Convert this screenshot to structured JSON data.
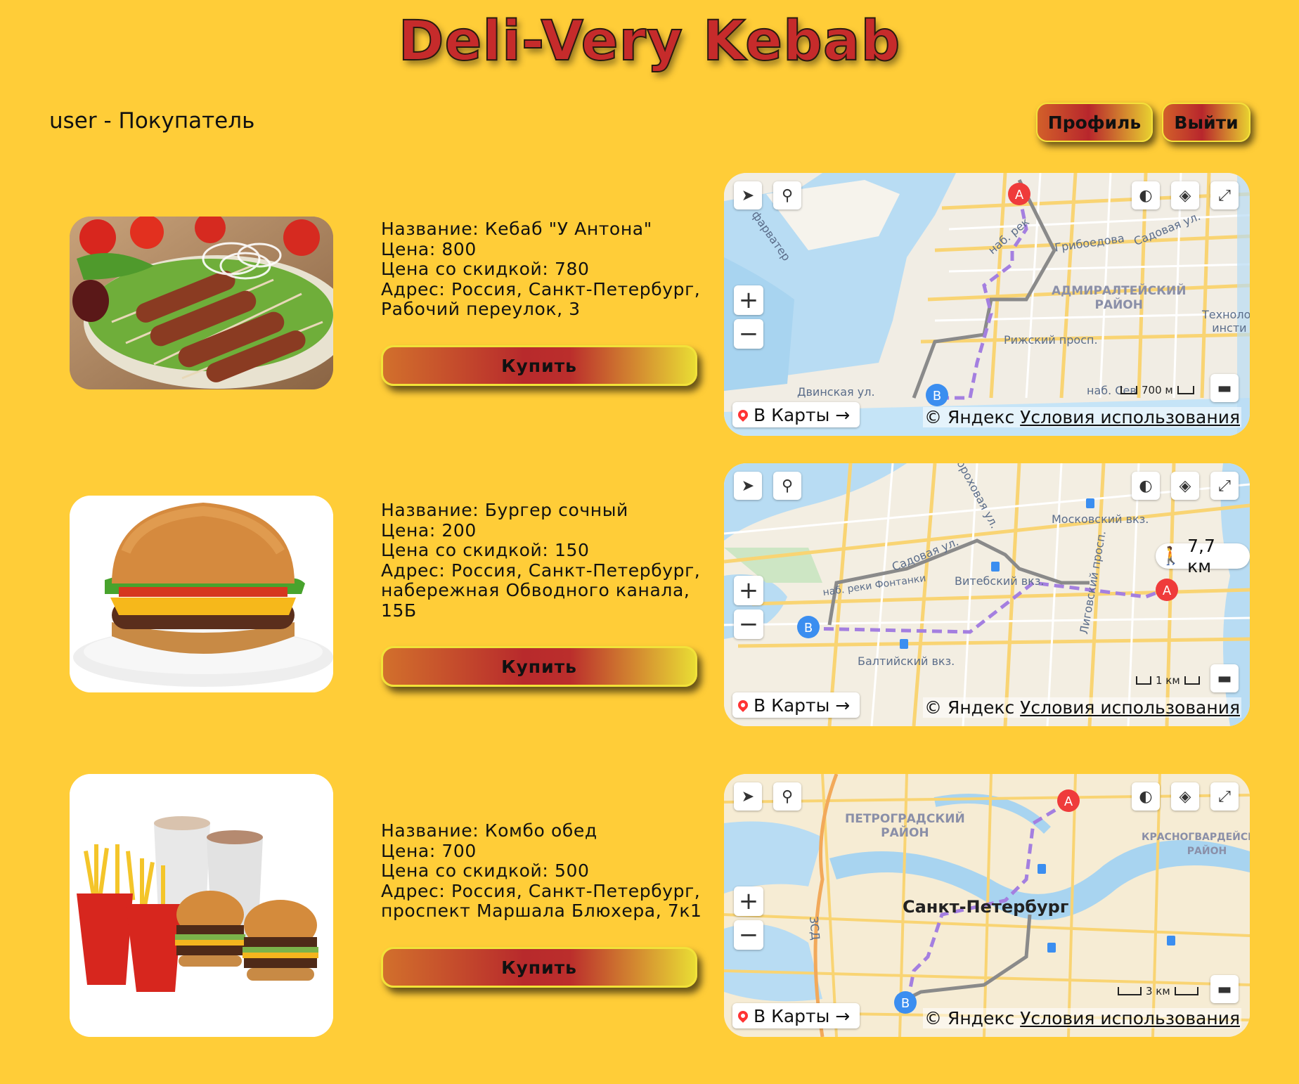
{
  "header": {
    "title": "Deli-Very Kebab",
    "user_line": "user - Покупатель",
    "profile_label": "Профиль",
    "logout_label": "Выйти"
  },
  "colors": {
    "background": "#ffcd38",
    "title_red": "#c62b2b",
    "route_purple": "#a47fe0"
  },
  "products": [
    {
      "name_line": "Название: Кебаб \"У Антона\"",
      "price_line": "Цена: 800",
      "discount_line": "Цена со скидкой: 780",
      "address_line1": "Адрес: Россия, Санкт-Петербург,",
      "address_line2": "Рабочий переулок, 3",
      "address_line3": "",
      "buy_label": "Купить",
      "image_icon": "kebab-photo"
    },
    {
      "name_line": "Название: Бургер сочный",
      "price_line": "Цена: 200",
      "discount_line": "Цена со скидкой: 150",
      "address_line1": "Адрес: Россия, Санкт-Петербург,",
      "address_line2": "набережная Обводного канала,",
      "address_line3": "15Б",
      "buy_label": "Купить",
      "image_icon": "burger-photo"
    },
    {
      "name_line": "Название: Комбо обед",
      "price_line": "Цена: 700",
      "discount_line": "Цена со скидкой: 500",
      "address_line1": "Адрес: Россия, Санкт-Петербург,",
      "address_line2": "проспект Маршала Блюхера, 7к1",
      "address_line3": "",
      "buy_label": "Купить",
      "image_icon": "combo-meal-photo"
    }
  ],
  "maps": [
    {
      "open_label": "В Карты →",
      "copyright": "© Яндекс",
      "terms": "Условия использования",
      "scale": "700 м",
      "distance": "",
      "labels": {
        "l1": "АДМИРАЛТЕЙСКИЙ\nРАЙОН",
        "l2": "Рижский просп.",
        "l3": "Садовая ул.",
        "l4": "наб. Сев",
        "l5": "Двинская ул.",
        "l6": "Технолог\nинсти",
        "l7": "фарватер",
        "l8": "наб. рек",
        "l9": "Грибоедова"
      }
    },
    {
      "open_label": "В Карты →",
      "copyright": "© Яндекс",
      "terms": "Условия использования",
      "scale": "1 км",
      "distance": "7,7 км",
      "labels": {
        "l1": "Московский вкз.",
        "l2": "Витебский вкз.",
        "l3": "Балтийский вкз.",
        "l4": "Садовая ул.",
        "l5": "наб. реки Фонтанки",
        "l6": "Лиговский просп.",
        "l7": "Гороховая ул."
      }
    },
    {
      "open_label": "В Карты →",
      "copyright": "© Яндекс",
      "terms": "Условия использования",
      "scale": "3 км",
      "distance": "",
      "labels": {
        "l1": "Санкт-Петербург",
        "l2": "ПЕТРОГРАДСКИЙ\nРАЙОН",
        "l3": "КРАСНОГВАРДЕЙСКИЙ\nРАЙОН",
        "l4": "ЗСД"
      }
    }
  ]
}
